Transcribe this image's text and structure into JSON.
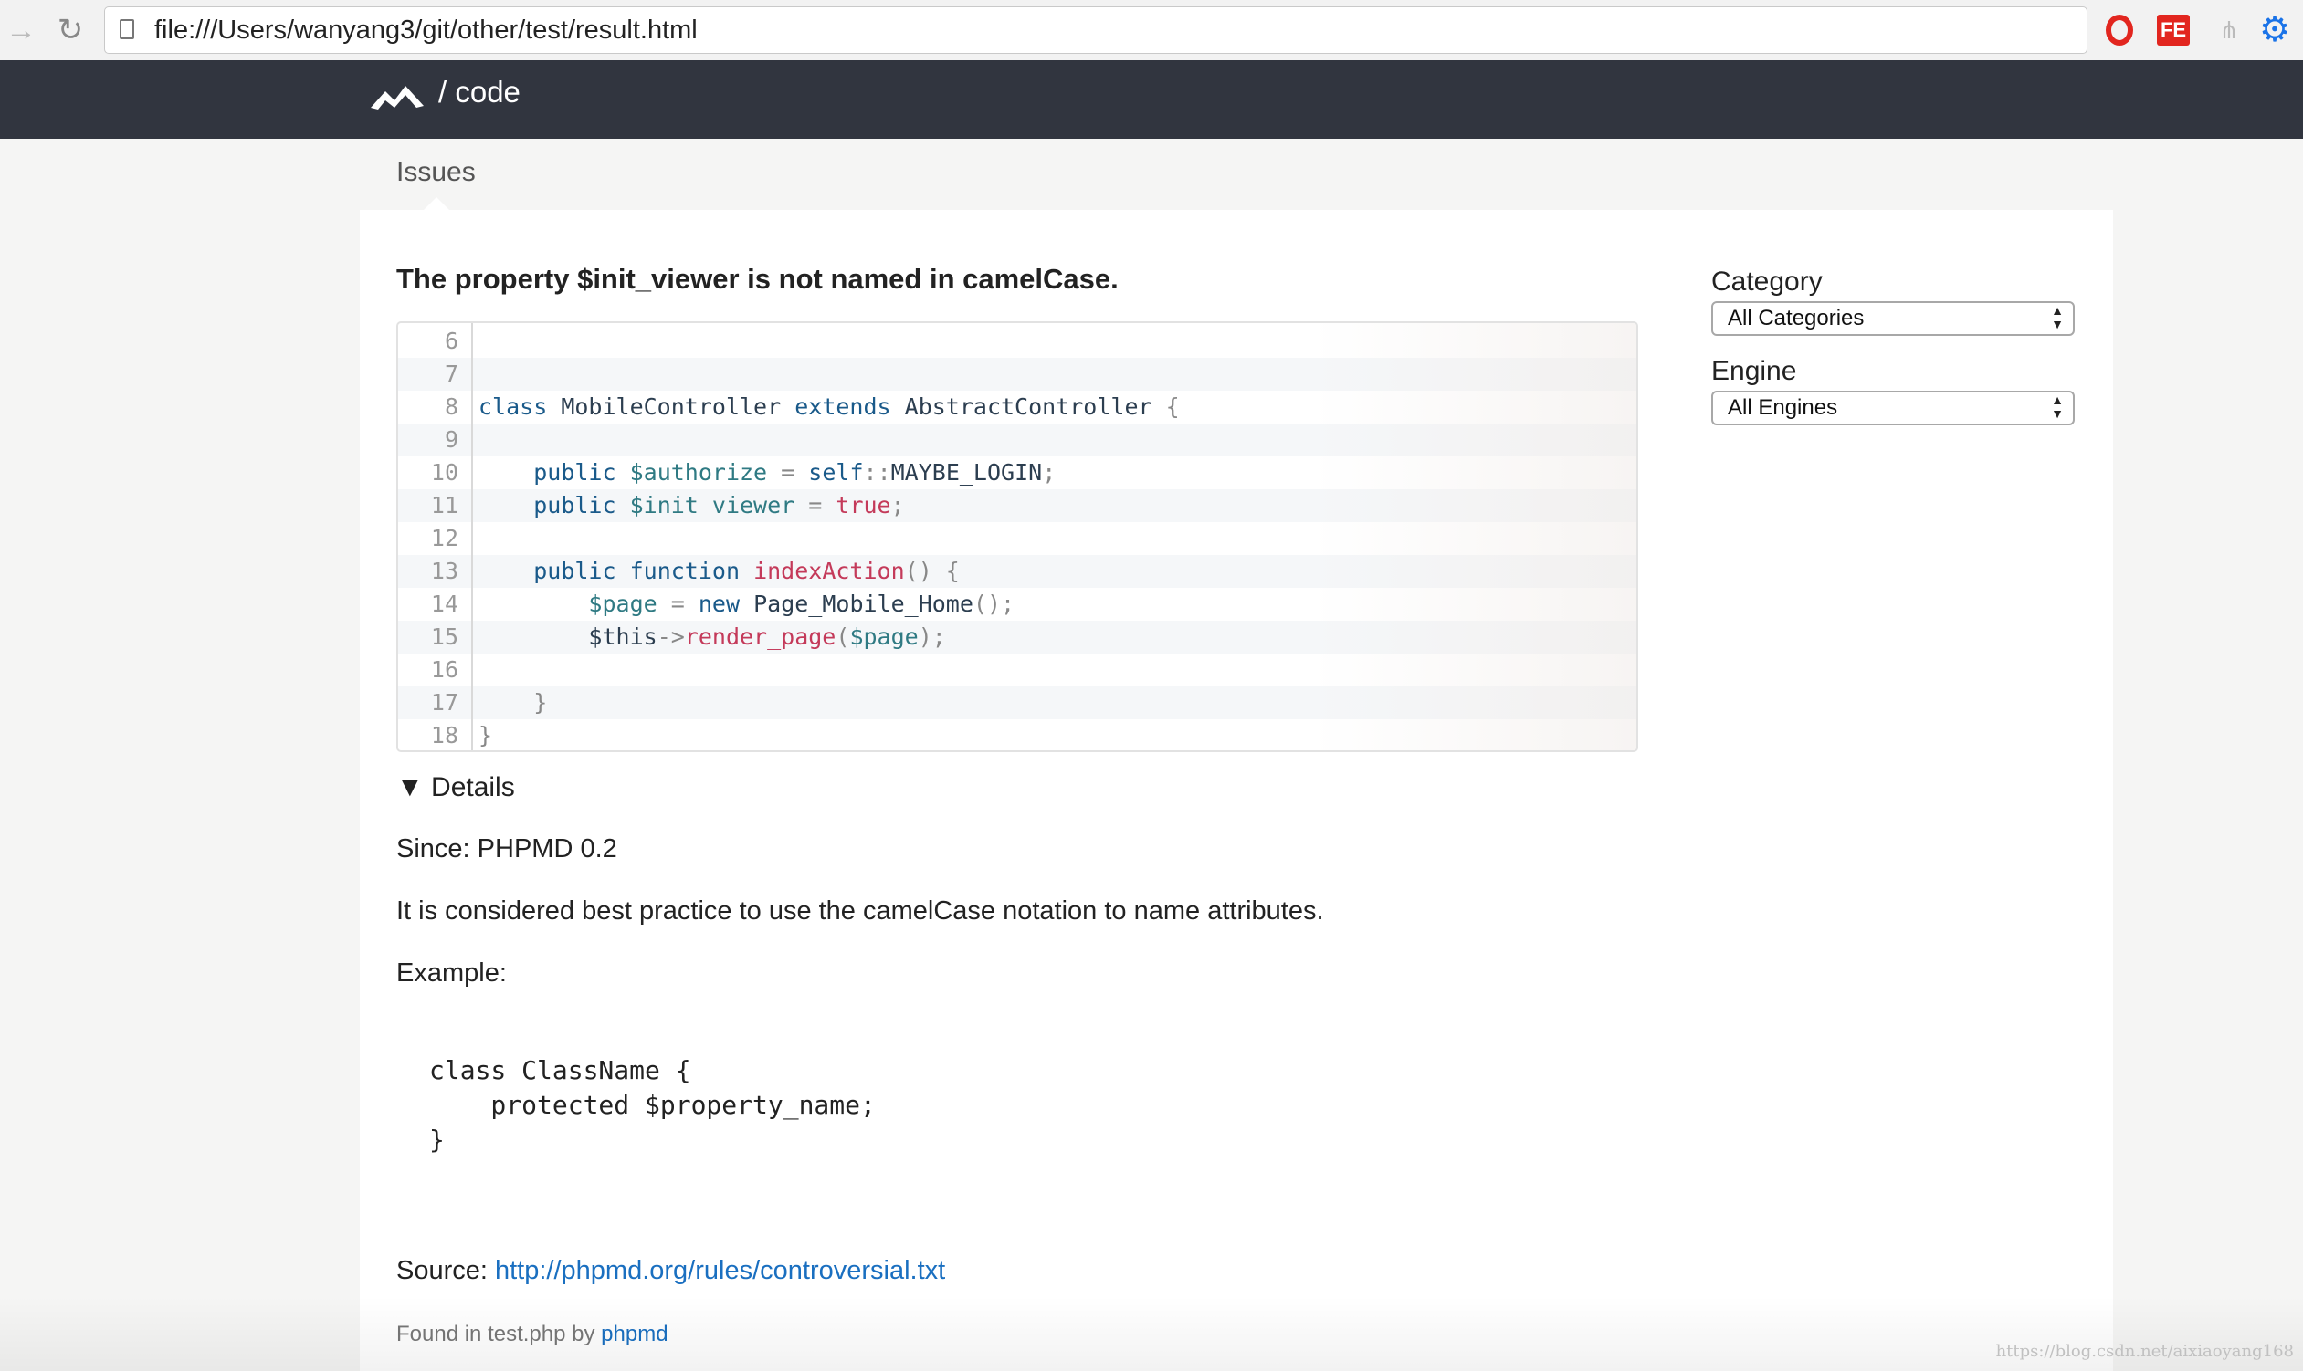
{
  "browser": {
    "url": "file:///Users/wanyang3/git/other/test/result.html",
    "extensions": [
      "opera-icon",
      "fe-icon",
      "sitemap-icon",
      "settings-gear-icon"
    ],
    "fe_label": "FE"
  },
  "header": {
    "brand": "/ code"
  },
  "tabs": {
    "active": "Issues"
  },
  "issue": {
    "title": "The property $init_viewer is not named in camelCase.",
    "code_lines": [
      {
        "n": "6",
        "html": ""
      },
      {
        "n": "7",
        "html": ""
      },
      {
        "n": "8",
        "html": "<span class='kw'>class</span> <span class='plain'>MobileController</span> <span class='kw'>extends</span> <span class='plain'>AbstractController</span> <span class='pun'>{</span>"
      },
      {
        "n": "9",
        "html": ""
      },
      {
        "n": "10",
        "html": "    <span class='kw'>public</span> <span class='var'>$authorize</span> <span class='pun'>=</span> <span class='kw'>self</span><span class='pun'>::</span><span class='plain'>MAYBE_LOGIN</span><span class='pun'>;</span>"
      },
      {
        "n": "11",
        "html": "    <span class='kw'>public</span> <span class='var'>$init_viewer</span> <span class='pun'>=</span> <span class='fn'>true</span><span class='pun'>;</span>"
      },
      {
        "n": "12",
        "html": ""
      },
      {
        "n": "13",
        "html": "    <span class='kw'>public</span> <span class='kw'>function</span> <span class='fn'>indexAction</span><span class='pun'>() {</span>"
      },
      {
        "n": "14",
        "html": "        <span class='var'>$page</span> <span class='pun'>=</span> <span class='kw'>new</span> <span class='plain'>Page_Mobile_Home</span><span class='pun'>();</span>"
      },
      {
        "n": "15",
        "html": "        <span class='plain'>$this</span><span class='pun'>-&gt;</span><span class='fn'>render_page</span><span class='pun'>(</span><span class='var'>$page</span><span class='pun'>);</span>"
      },
      {
        "n": "16",
        "html": ""
      },
      {
        "n": "17",
        "html": "    <span class='pun'>}</span>"
      },
      {
        "n": "18",
        "html": "<span class='pun'>}</span>"
      }
    ],
    "details_label": "▼ Details",
    "since": "Since: PHPMD 0.2",
    "description": "It is considered best practice to use the camelCase notation to name attributes.",
    "example_label": "Example:",
    "example_code": "class ClassName {\n    protected $property_name;\n}",
    "source_label": "Source: ",
    "source_link": "http://phpmd.org/rules/controversial.txt",
    "found_prefix": "Found in test.php by ",
    "found_link": "phpmd"
  },
  "filters": {
    "category_label": "Category",
    "category_value": "All Categories",
    "engine_label": "Engine",
    "engine_value": "All Engines"
  },
  "watermark": "https://blog.csdn.net/aixiaoyang168"
}
